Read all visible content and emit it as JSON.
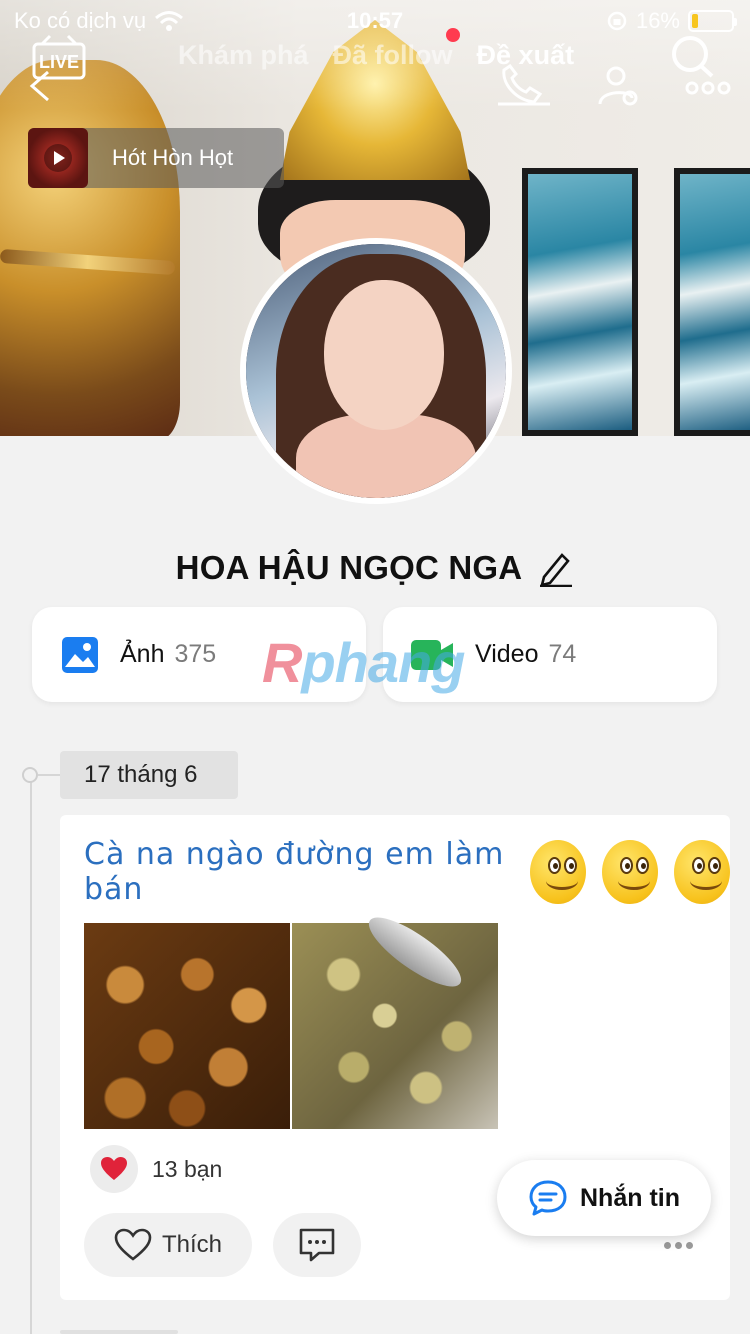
{
  "status_bar": {
    "carrier": "Ko có dịch vụ",
    "time": "10:57",
    "battery_percent": "16%",
    "battery_color": "#f7c51f"
  },
  "nav": {
    "live_label": "LIVE",
    "tabs": [
      {
        "label": "Khám phá",
        "active": false
      },
      {
        "label": "Đã follow",
        "active": false
      },
      {
        "label": "Đề xuất",
        "active": true
      }
    ],
    "icons": [
      "back-icon",
      "phone-icon",
      "user-settings-icon",
      "search-more-icon"
    ]
  },
  "music": {
    "title": "Hót Hòn Họt"
  },
  "profile": {
    "name": "HOA HẬU NGỌC NGA"
  },
  "media": {
    "photos_label": "Ảnh",
    "photos_count": "375",
    "videos_label": "Video",
    "videos_count": "74",
    "photos_icon_color": "#1a7df0",
    "videos_icon_color": "#27b45a"
  },
  "watermark": {
    "prefix": "R",
    "text": "phang"
  },
  "timeline": {
    "date": "17 tháng 6"
  },
  "post": {
    "title": "Cà na ngào đường em làm bán",
    "emoji_count": 3,
    "reaction_count": "13 bạn",
    "like_label": "Thích"
  },
  "fab": {
    "message_label": "Nhắn tin"
  },
  "colors": {
    "accent_blue": "#2b6fbf",
    "heart_red": "#e0233a",
    "notification_dot": "#ff3b4f"
  }
}
